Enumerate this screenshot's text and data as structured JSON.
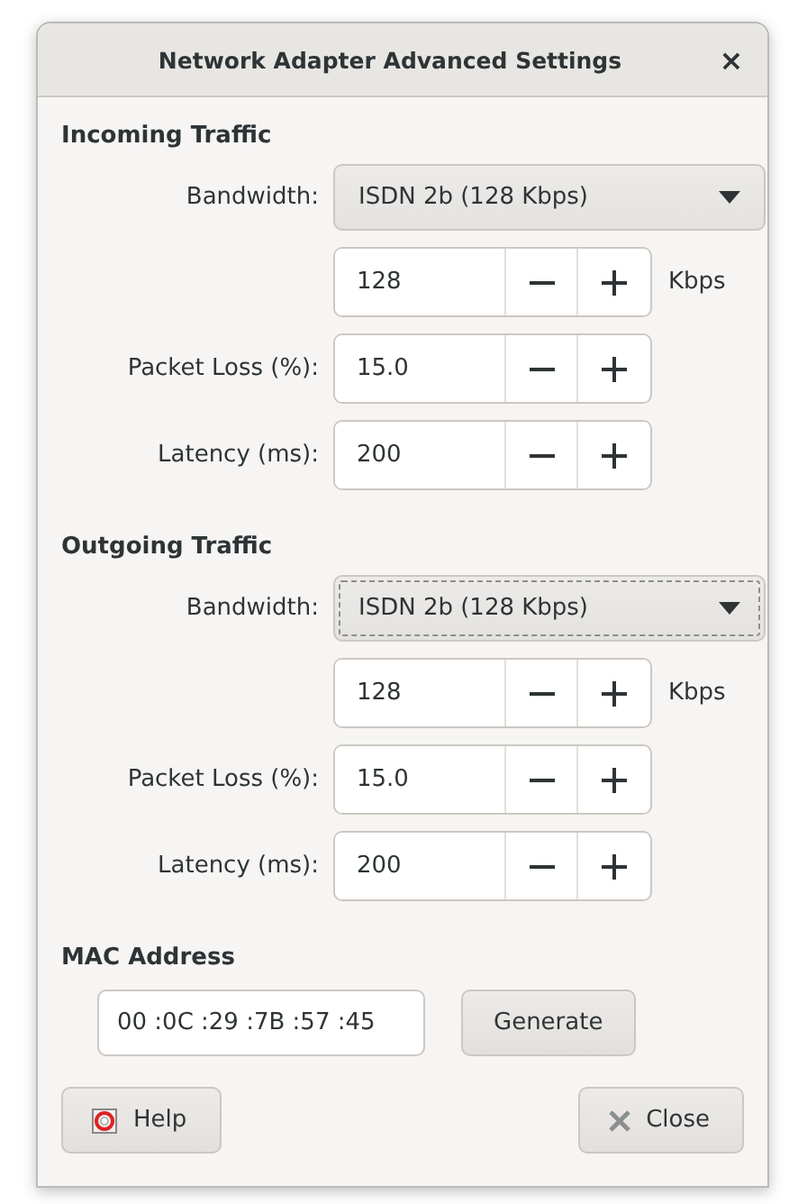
{
  "window": {
    "title": "Network Adapter Advanced Settings",
    "close": "×"
  },
  "sections": [
    {
      "title": "Incoming Traffic",
      "bandwidth": {
        "label": "Bandwidth:",
        "value": "ISDN 2b (128 Kbps)",
        "focused": false
      },
      "rate": {
        "value": "128",
        "unit": "Kbps"
      },
      "packet_loss": {
        "label": "Packet Loss (%):",
        "value": "15.0"
      },
      "latency": {
        "label": "Latency (ms):",
        "value": "200"
      }
    },
    {
      "title": "Outgoing Traffic",
      "bandwidth": {
        "label": "Bandwidth:",
        "value": "ISDN 2b (128 Kbps)",
        "focused": true
      },
      "rate": {
        "value": "128",
        "unit": "Kbps"
      },
      "packet_loss": {
        "label": "Packet Loss (%):",
        "value": "15.0"
      },
      "latency": {
        "label": "Latency (ms):",
        "value": "200"
      }
    }
  ],
  "mac": {
    "title": "MAC Address",
    "value": "00 :0C :29 :7B :57 :45",
    "button": "Generate"
  },
  "buttons": [
    {
      "label": "Help",
      "kind": "help"
    },
    {
      "label": "Close",
      "kind": "close"
    }
  ]
}
